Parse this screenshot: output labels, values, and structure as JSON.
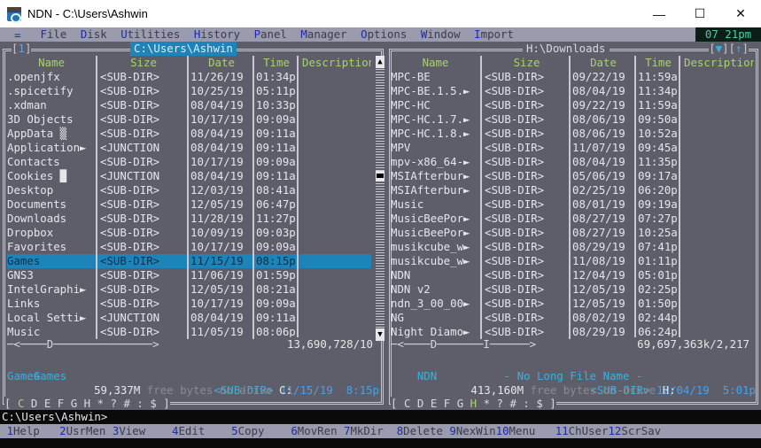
{
  "window": {
    "title": "NDN - C:\\Users\\Ashwin",
    "controls": {
      "minimize": "—",
      "maximize": "☐",
      "close": "✕"
    }
  },
  "menubar": {
    "system_glyph": "=",
    "items": [
      {
        "hot": "F",
        "rest": "ile"
      },
      {
        "hot": "D",
        "rest": "isk"
      },
      {
        "hot": "U",
        "rest": "tilities"
      },
      {
        "hot": "H",
        "rest": "istory"
      },
      {
        "hot": "P",
        "rest": "anel"
      },
      {
        "hot": "M",
        "rest": "anager"
      },
      {
        "hot": "O",
        "rest": "ptions"
      },
      {
        "hot": "W",
        "rest": "indow"
      },
      {
        "hot": "I",
        "rest": "mport"
      }
    ],
    "clock": "07 21pm"
  },
  "columns": {
    "name": "Name",
    "size": "Size",
    "date": "Date",
    "time": "Time",
    "description": "Description"
  },
  "left_panel": {
    "number_open": "[",
    "number": "1",
    "number_close": "]",
    "path": "C:\\Users\\Ashwin",
    "rows": [
      {
        "name": ".openjfx",
        "size": "<SUB-DIR>",
        "date": "11/26/19",
        "time": "01:34p"
      },
      {
        "name": ".spicetify",
        "size": "<SUB-DIR>",
        "date": "10/25/19",
        "time": "05:11p"
      },
      {
        "name": ".xdman",
        "size": "<SUB-DIR>",
        "date": "08/04/19",
        "time": "10:33p"
      },
      {
        "name": "3D Objects",
        "size": "<SUB-DIR>",
        "date": "10/17/19",
        "time": "09:09a"
      },
      {
        "name": "AppData ▒",
        "size": "<SUB-DIR>",
        "date": "08/04/19",
        "time": "09:11a"
      },
      {
        "name": "Application►",
        "size": "<JUNCTION",
        "date": "08/04/19",
        "time": "09:11a"
      },
      {
        "name": "Contacts",
        "size": "<SUB-DIR>",
        "date": "10/17/19",
        "time": "09:09a"
      },
      {
        "name": "Cookies █",
        "size": "<JUNCTION",
        "date": "08/04/19",
        "time": "09:11a"
      },
      {
        "name": "Desktop",
        "size": "<SUB-DIR>",
        "date": "12/03/19",
        "time": "08:41a"
      },
      {
        "name": "Documents",
        "size": "<SUB-DIR>",
        "date": "12/05/19",
        "time": "06:47p"
      },
      {
        "name": "Downloads",
        "size": "<SUB-DIR>",
        "date": "11/28/19",
        "time": "11:27p"
      },
      {
        "name": "Dropbox",
        "size": "<SUB-DIR>",
        "date": "10/09/19",
        "time": "09:03p"
      },
      {
        "name": "Favorites",
        "size": "<SUB-DIR>",
        "date": "10/17/19",
        "time": "09:09a"
      },
      {
        "name": "Games",
        "size": "<SUB-DIR>",
        "date": "11/15/19",
        "time": "08:15p",
        "selected": true
      },
      {
        "name": "GNS3",
        "size": "<SUB-DIR>",
        "date": "11/06/19",
        "time": "01:59p"
      },
      {
        "name": "IntelGraphi►",
        "size": "<SUB-DIR>",
        "date": "12/05/19",
        "time": "08:21a"
      },
      {
        "name": "Links",
        "size": "<SUB-DIR>",
        "date": "10/17/19",
        "time": "09:09a"
      },
      {
        "name": "Local Setti►",
        "size": "<JUNCTION",
        "date": "08/04/19",
        "time": "09:11a"
      },
      {
        "name": "Music",
        "size": "<SUB-DIR>",
        "date": "11/05/19",
        "time": "08:06p"
      }
    ],
    "separator": "─<────D───────────────>",
    "total": "13,690,728/10",
    "info_name": "Games",
    "info_size": "<SUB-DIR>",
    "info_date": "11/15/19",
    "info_time": " 8:15p",
    "long_name": "Games",
    "free_amount": "59,337M",
    "free_label": " free bytes on drive ",
    "free_drive": "C:",
    "drives": [
      "C",
      "D",
      "E",
      "F",
      "G",
      "H",
      "*",
      "?",
      "#",
      ":",
      "$"
    ],
    "active_drive": "C"
  },
  "right_panel": {
    "path": "H:\\Downloads",
    "controls_left": "[",
    "sort_icon": "▼",
    "controls_mid": "][",
    "up_icon": "↑",
    "controls_right": "]",
    "rows": [
      {
        "name": "MPC-BE",
        "size": "<SUB-DIR>",
        "date": "09/22/19",
        "time": "11:59a"
      },
      {
        "name": "MPC-BE.1.5.►",
        "size": "<SUB-DIR>",
        "date": "08/04/19",
        "time": "11:34p"
      },
      {
        "name": "MPC-HC",
        "size": "<SUB-DIR>",
        "date": "09/22/19",
        "time": "11:59a"
      },
      {
        "name": "MPC-HC.1.7.►",
        "size": "<SUB-DIR>",
        "date": "08/06/19",
        "time": "09:50a"
      },
      {
        "name": "MPC-HC.1.8.►",
        "size": "<SUB-DIR>",
        "date": "08/06/19",
        "time": "10:52a"
      },
      {
        "name": "MPV",
        "size": "<SUB-DIR>",
        "date": "11/07/19",
        "time": "09:45a"
      },
      {
        "name": "mpv-x86_64-►",
        "size": "<SUB-DIR>",
        "date": "08/04/19",
        "time": "11:35p"
      },
      {
        "name": "MSIAfterbur►",
        "size": "<SUB-DIR>",
        "date": "05/06/19",
        "time": "09:17a"
      },
      {
        "name": "MSIAfterbur►",
        "size": "<SUB-DIR>",
        "date": "02/25/19",
        "time": "06:20p"
      },
      {
        "name": "Music",
        "size": "<SUB-DIR>",
        "date": "08/01/19",
        "time": "09:19a"
      },
      {
        "name": "MusicBeePor►",
        "size": "<SUB-DIR>",
        "date": "08/27/19",
        "time": "07:27p"
      },
      {
        "name": "MusicBeePor►",
        "size": "<SUB-DIR>",
        "date": "08/27/19",
        "time": "10:25a"
      },
      {
        "name": "musikcube_w►",
        "size": "<SUB-DIR>",
        "date": "08/29/19",
        "time": "07:41p"
      },
      {
        "name": "musikcube_w►",
        "size": "<SUB-DIR>",
        "date": "11/08/19",
        "time": "01:11p"
      },
      {
        "name": "NDN",
        "size": "<SUB-DIR>",
        "date": "12/04/19",
        "time": "05:01p"
      },
      {
        "name": "NDN v2",
        "size": "<SUB-DIR>",
        "date": "12/05/19",
        "time": "02:25p"
      },
      {
        "name": "ndn_3_00_00►",
        "size": "<SUB-DIR>",
        "date": "12/05/19",
        "time": "01:50p"
      },
      {
        "name": "NG",
        "size": "<SUB-DIR>",
        "date": "08/02/19",
        "time": "02:44p"
      },
      {
        "name": "Night Diamo►",
        "size": "<SUB-DIR>",
        "date": "08/29/19",
        "time": "06:24p"
      }
    ],
    "separator": "─<────D───────I──────>",
    "total": "69,697,363k/2,217",
    "info_name": "NDN",
    "info_size": "<SUB-DIR>",
    "info_date": "12/04/19",
    "info_time": " 5:01p",
    "long_name": "- No Long File Name -",
    "free_amount": "413,160M",
    "free_label": " free bytes on drive ",
    "free_drive": "H:",
    "drives": [
      "C",
      "D",
      "E",
      "F",
      "G",
      "H",
      "*",
      "?",
      "#",
      ":",
      "$"
    ],
    "active_drive": "H"
  },
  "scrollbar": {
    "up": "▲",
    "down": "▼"
  },
  "command_line": "C:\\Users\\Ashwin>",
  "function_keys": [
    {
      "num": "1",
      "label": "Help   "
    },
    {
      "num": "2",
      "label": "UsrMen "
    },
    {
      "num": "3",
      "label": "View    "
    },
    {
      "num": "4",
      "label": "Edit    "
    },
    {
      "num": "5",
      "label": "Copy    "
    },
    {
      "num": "6",
      "label": "MovRen "
    },
    {
      "num": "7",
      "label": "MkDir  "
    },
    {
      "num": "8",
      "label": "Delete "
    },
    {
      "num": "9",
      "label": "NexWin"
    },
    {
      "num": "10",
      "label": "Menu   "
    },
    {
      "num": "11",
      "label": "ChUser"
    },
    {
      "num": "12",
      "label": "ScrSav"
    }
  ]
}
